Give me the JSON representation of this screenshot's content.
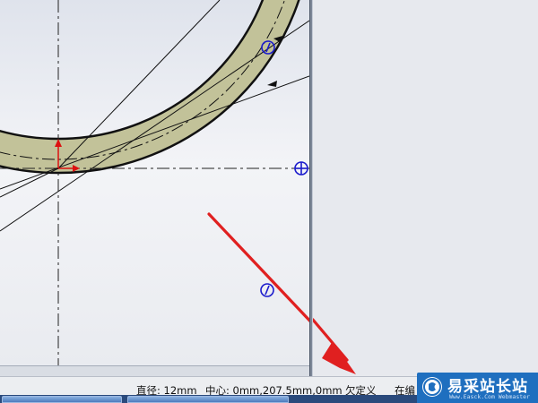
{
  "status_bar": {
    "diameter": "直径: 12mm",
    "center": "中心: 0mm,207.5mm,0mm",
    "state": "欠定义",
    "editing": "在编"
  },
  "watermark": {
    "title": "易采站长站",
    "subtitle": "Www.Easck.Com  Webmaster"
  },
  "colors": {
    "ring_fill": "#c2c299",
    "sketch_line": "#111111",
    "point_circle": "#1a1acc",
    "origin_arrow": "#dd1111",
    "annotation_arrow": "#e02020",
    "watermark_bg": "#1f6fbf"
  },
  "icons": [
    "origin-marker-icon",
    "sketch-point-icon",
    "annotation-arrow-icon",
    "watermark-logo-icon"
  ]
}
